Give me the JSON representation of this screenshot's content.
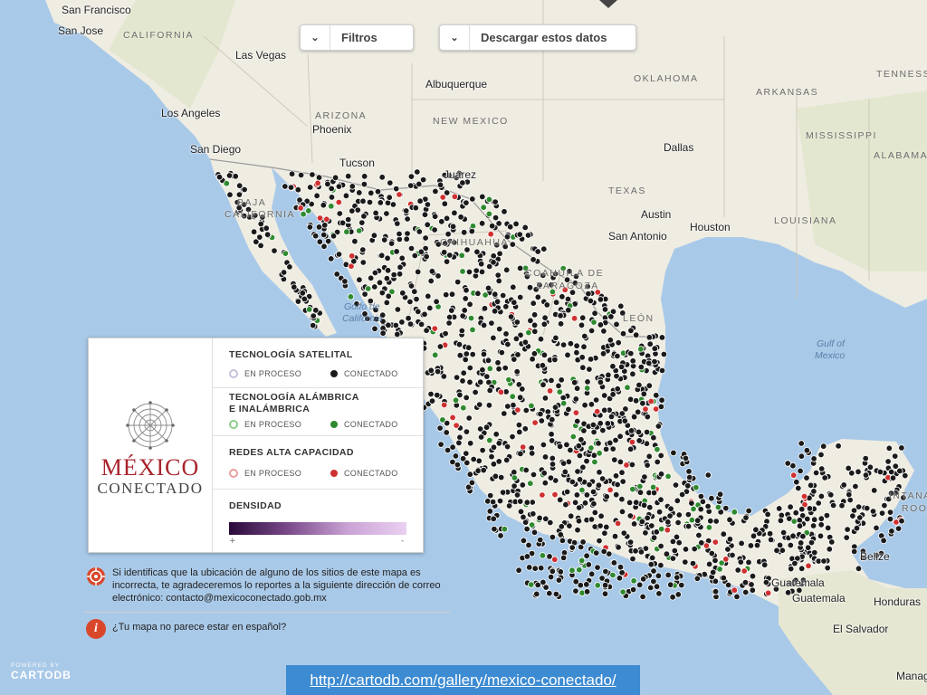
{
  "controls": {
    "filters_label": "Filtros",
    "download_label": "Descargar estos datos"
  },
  "places": {
    "cities": [
      "San Francisco",
      "San Jose",
      "Las Vegas",
      "Los Angeles",
      "Phoenix",
      "San Diego",
      "Tucson",
      "Albuquerque",
      "Juárez",
      "Dallas",
      "Austin",
      "Houston",
      "San Antonio",
      "Belize",
      "Guatemala",
      "Guatemala",
      "Honduras",
      "El Salvador",
      "Manag"
    ],
    "states": [
      "CALIFORNIA",
      "ARIZONA",
      "NEW MEXICO",
      "OKLAHOMA",
      "ARKANSAS",
      "TENNESSE",
      "MISSISSIPPI",
      "ALABAMA",
      "TEXAS",
      "LOUISIANA",
      "BAJA",
      "CALIFORNIA",
      "CHIHUAHUA",
      "COAHUILA DE",
      "ZARAGOZA",
      "LEÓN",
      "INTANA",
      "ROO"
    ],
    "water": [
      "Golfo de",
      "California",
      "Gulf of",
      "Mexico"
    ]
  },
  "legend": {
    "brand_line1": "MÉXICO",
    "brand_line2": "CONECTADO",
    "sections": [
      {
        "title": "TECNOLOGÍA SATELITAL",
        "options": [
          "EN PROCESO",
          "CONECTADO"
        ],
        "colors": [
          "#c9c0dc",
          "#1a1a1a"
        ]
      },
      {
        "title": "TECNOLOGÍA ALÁMBRICA\nE INALÁMBRICA",
        "options": [
          "EN PROCESO",
          "CONECTADO"
        ],
        "colors": [
          "#8ccf8c",
          "#2f8a2f"
        ]
      },
      {
        "title": "REDES ALTA CAPACIDAD",
        "options": [
          "EN PROCESO",
          "CONECTADO"
        ],
        "colors": [
          "#e8a0a0",
          "#d03030"
        ]
      }
    ],
    "density_title": "DENSIDAD",
    "density_min": "+",
    "density_max": "-"
  },
  "notes": {
    "report_text": "Si identificas que la ubicación de alguno de los sitios de este mapa es incorrecta, te agradeceremos lo reportes a la siguiente dirección de correo electrónico: contacto@mexicoconectado.gob.mx",
    "language_text": "¿Tu mapa no parece estar en español?",
    "language_icon_glyph": "i"
  },
  "attribution": {
    "powered_by": "POWERED BY",
    "brand": "CARTODB"
  },
  "url": "http://cartodb.com/gallery/mexico-conectado/",
  "colors": {
    "land": "#efece2",
    "land_green": "#dfe6c8",
    "water": "#a9c9e8",
    "dot_black": "#1a1a1a",
    "dot_green": "#2f8a2f",
    "dot_red": "#d03030",
    "url_box": "#3d8bd2"
  }
}
